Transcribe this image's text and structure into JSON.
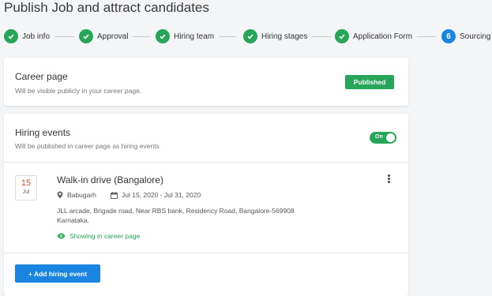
{
  "page": {
    "title": "Publish Job and attract candidates"
  },
  "stepper": {
    "steps": [
      {
        "label": "Job info",
        "status": "done"
      },
      {
        "label": "Approval",
        "status": "done"
      },
      {
        "label": "Hiring team",
        "status": "done"
      },
      {
        "label": "Hiring stages",
        "status": "done"
      },
      {
        "label": "Application Form",
        "status": "done"
      },
      {
        "label": "Sourcing",
        "status": "active",
        "number": "6"
      }
    ]
  },
  "career_page": {
    "title": "Career page",
    "subtitle": "Will be visible publicly in your career page.",
    "status_label": "Published"
  },
  "hiring_events": {
    "title": "Hiring events",
    "subtitle": "Will be published in career page as hiring events",
    "toggle_label": "On",
    "events": [
      {
        "day": "15",
        "month": "Jul",
        "title": "Walk-in drive (Bangalore)",
        "location": "Babugarh",
        "dates": "Jul 15, 2020 - Jul 31, 2020",
        "address_line1": "JLL arcade, Brigade road, Near RBS bank, Residency Road, Bangalore-569908",
        "address_line2": "Karnataka.",
        "visibility": "Showing in career page"
      }
    ],
    "add_button_label": "+ Add hiring event"
  },
  "colors": {
    "success": "#27a65a",
    "primary": "#1a85e0",
    "date_red": "#e0463b",
    "background": "#f4f5f7"
  }
}
